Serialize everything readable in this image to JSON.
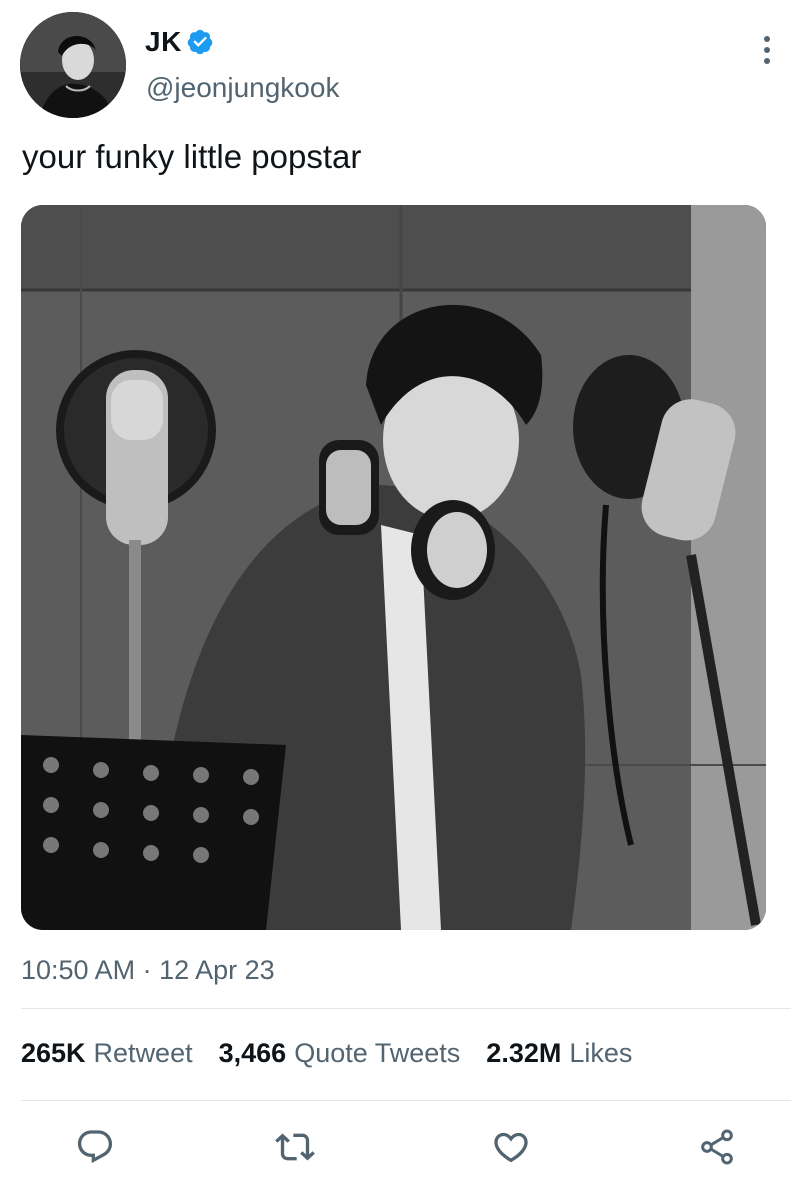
{
  "author": {
    "display_name": "JK",
    "handle": "@jeonjungkook",
    "verified": true
  },
  "tweet": {
    "text": "your funky little popstar",
    "timestamp": "10:50 AM · 12 Apr 23"
  },
  "stats": {
    "retweets": {
      "count": "265K",
      "label": "Retweet"
    },
    "quotes": {
      "count": "3,466",
      "label": "Quote Tweets"
    },
    "likes": {
      "count": "2.32M",
      "label": "Likes"
    }
  },
  "actions": [
    "reply-icon",
    "retweet-icon",
    "like-icon",
    "share-icon"
  ],
  "colors": {
    "text": "#0f1419",
    "muted": "#536471",
    "verified": "#1d9bf0",
    "divider": "#e3e7ea"
  }
}
